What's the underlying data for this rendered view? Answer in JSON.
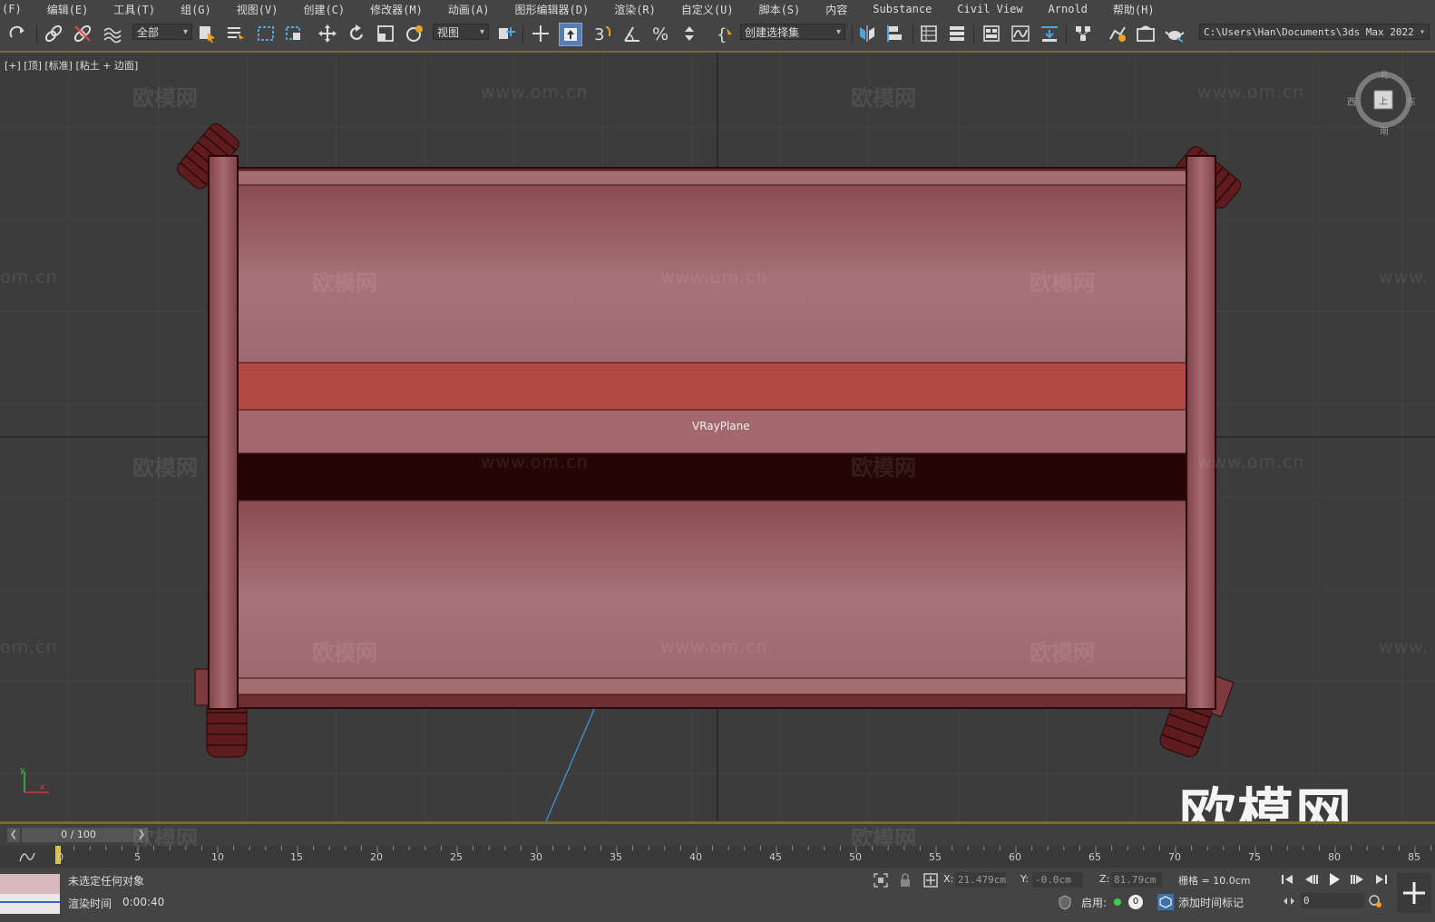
{
  "menu": [
    "(F)",
    "编辑(E)",
    "工具(T)",
    "组(G)",
    "视图(V)",
    "创建(C)",
    "修改器(M)",
    "动画(A)",
    "图形编辑器(D)",
    "渲染(R)",
    "自定义(U)",
    "脚本(S)",
    "内容",
    "Substance",
    "Civil View",
    "Arnold",
    "帮助(H)"
  ],
  "toolbar": {
    "filter_dropdown": "全部",
    "coord_dropdown": "视图",
    "selection_set_dropdown": "创建选择集",
    "project_path": "C:\\Users\\Han\\Documents\\3ds Max 2022"
  },
  "viewport": {
    "label": "[+] [顶] [标准] [粘土 + 边面]",
    "object_label": "VRayPlane",
    "watermark_cn": "欧模网",
    "watermark_url": "www.om.cn",
    "watermark_url_partial": "om.cn",
    "watermark_url_partial_right": "www.",
    "logo_watermark": "欧模网",
    "viewcube": {
      "face": "上",
      "north": "北",
      "south": "南",
      "east": "东",
      "west": "西"
    }
  },
  "timeline": {
    "frame_display": "0 / 100",
    "ticks": [
      "0",
      "5",
      "10",
      "15",
      "20",
      "25",
      "30",
      "35",
      "40",
      "45",
      "50",
      "55",
      "60",
      "65",
      "70",
      "75",
      "80",
      "85"
    ]
  },
  "status": {
    "selection_text": "未选定任何对象",
    "render_time_label": "渲染时间",
    "render_time_value": "0:00:40",
    "x_label": "X:",
    "x_value": "21.479cm",
    "y_label": "Y:",
    "y_value": "-0.0cm",
    "z_label": "Z:",
    "z_value": "81.79cm",
    "grid_text": "栅格 = 10.0cm",
    "enable_label": "启用:",
    "enable_value": "0",
    "add_time_tag": "添加时间标记",
    "frame_input": "0"
  },
  "colors": {
    "cart_body": "#9a5e62",
    "cart_red_band": "#b04a42",
    "cart_dark_band": "#230605",
    "accent_yellow": "#7a6a2a"
  }
}
